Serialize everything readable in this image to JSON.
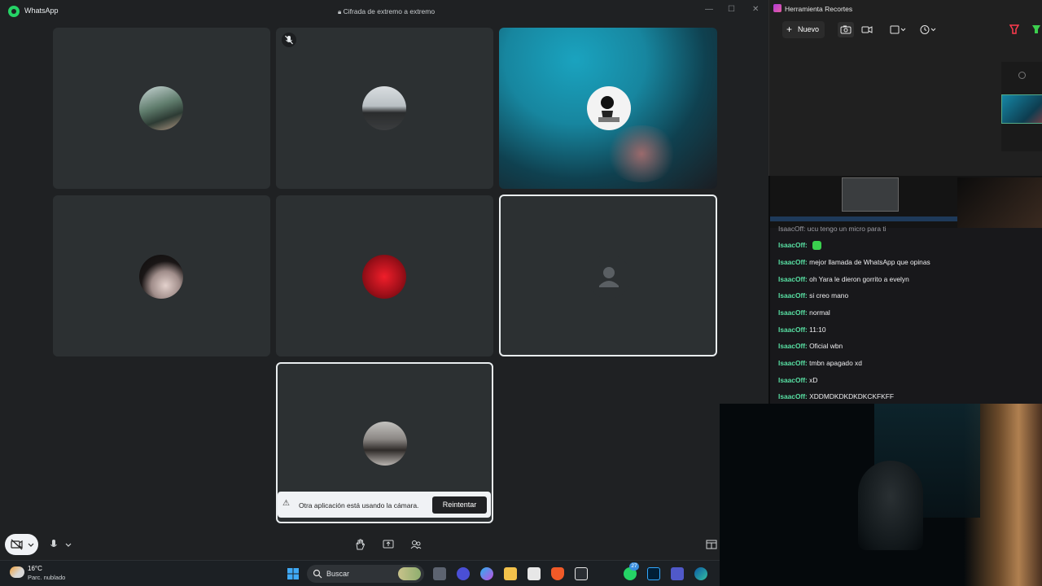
{
  "whatsapp": {
    "title": "WhatsApp",
    "encryption": "Cifrada de extremo a extremo",
    "window_controls": [
      "—",
      "☐",
      "✕"
    ],
    "camera_warning": {
      "text": "Otra aplicación está usando la cámara.",
      "retry": "Reintentar"
    }
  },
  "snipping_tool": {
    "title": "Herramienta Recortes",
    "new_label": "Nuevo"
  },
  "chat": {
    "partial_top": "IsaacOff: ucu tengo un micro para ti",
    "messages": [
      {
        "user": "IsaacOff:",
        "text": ""
      },
      {
        "user": "IsaacOff:",
        "text": " mejor llamada de WhatsApp que opinas"
      },
      {
        "user": "IsaacOff:",
        "text": " oh Yara le dieron gorrito a evelyn"
      },
      {
        "user": "IsaacOff:",
        "text": " si creo mano"
      },
      {
        "user": "IsaacOff:",
        "text": " normal"
      },
      {
        "user": "IsaacOff:",
        "text": " 11:10"
      },
      {
        "user": "IsaacOff:",
        "text": " Oficial wbn"
      },
      {
        "user": "IsaacOff:",
        "text": " tmbn apagado xd"
      },
      {
        "user": "IsaacOff:",
        "text": " xD"
      },
      {
        "user": "IsaacOff:",
        "text": " XDDMDKDKDKDKCKFKFF"
      }
    ]
  },
  "taskbar": {
    "weather_temp": "16°C",
    "weather_desc": "Parc. nublado",
    "search_placeholder": "Buscar",
    "whatsapp_badge": "27"
  },
  "colors": {
    "tile_bg": "#2c3032",
    "chat_username": "#58e0a3",
    "whatsapp_green": "#25d366"
  }
}
